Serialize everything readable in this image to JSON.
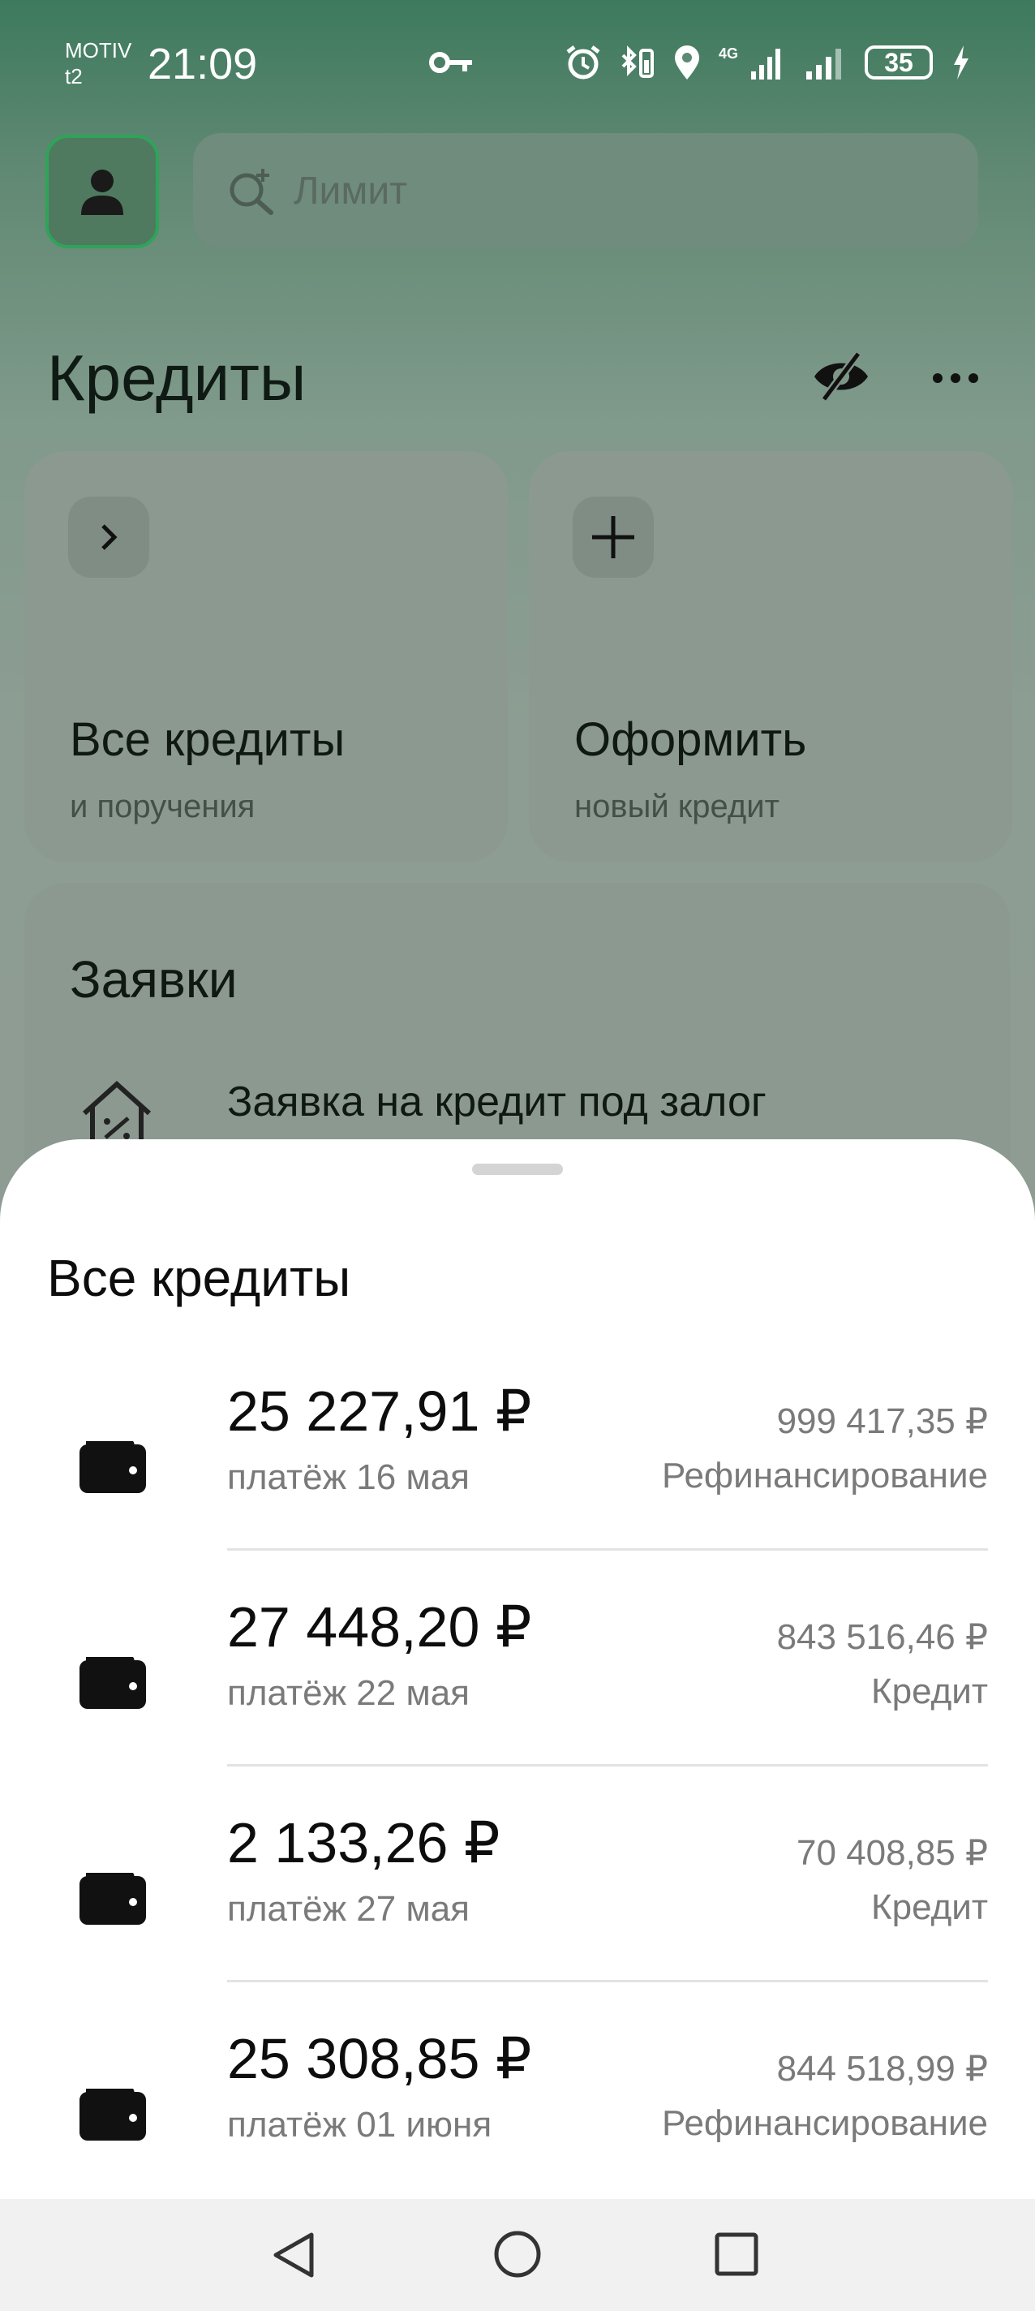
{
  "status_bar": {
    "carrier_top": "MOTIV",
    "carrier_bottom": "t2",
    "time": "21:09",
    "network": "4G",
    "battery": "35",
    "icons": [
      "vpn-key-icon",
      "alarm-icon",
      "bluetooth-battery-icon",
      "location-icon",
      "signal-icon",
      "charging-icon"
    ]
  },
  "header": {
    "search_placeholder": "Лимит"
  },
  "page": {
    "title": "Кредиты"
  },
  "tiles": [
    {
      "title": "Все кредиты",
      "subtitle": "и поручения",
      "icon": "chevron-right-icon"
    },
    {
      "title": "Оформить",
      "subtitle": "новый кредит",
      "icon": "plus-icon"
    }
  ],
  "requests": {
    "title": "Заявки",
    "item_text": "Заявка на кредит под залог"
  },
  "sheet": {
    "title": "Все кредиты",
    "loans": [
      {
        "amount": "25 227,91 ₽",
        "date": "платёж 16 мая",
        "balance": "999 417,35 ₽",
        "type": "Рефинансирование"
      },
      {
        "amount": "27 448,20 ₽",
        "date": "платёж 22 мая",
        "balance": "843 516,46 ₽",
        "type": "Кредит"
      },
      {
        "amount": "2 133,26 ₽",
        "date": "платёж 27 мая",
        "balance": "70 408,85 ₽",
        "type": "Кредит"
      },
      {
        "amount": "25 308,85 ₽",
        "date": "платёж 01 июня",
        "balance": "844 518,99 ₽",
        "type": "Рефинансирование"
      }
    ]
  },
  "colors": {
    "accent_green": "#2fa35a",
    "sheet_bg": "#ffffff",
    "muted_text": "#7a7a7a"
  }
}
